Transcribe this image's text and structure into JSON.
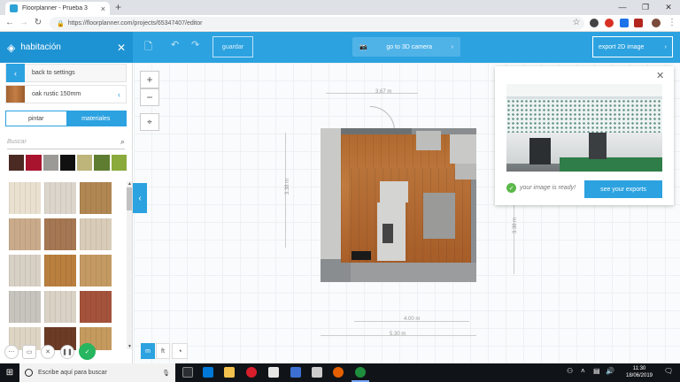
{
  "browser": {
    "tab_title": "Floorplanner - Prueba 3",
    "url": "https://floorplanner.com/projects/65347407/editor",
    "new_tab": "+",
    "tab_close": "×",
    "minimize": "—",
    "maximize": "❐",
    "close": "✕"
  },
  "sidebar": {
    "title": "habitación",
    "back_label": "back to settings",
    "material_label": "oak rustic 150mm",
    "tabs": [
      "pintar",
      "materiales"
    ],
    "search_placeholder": "Buscar",
    "swatch_colors": [
      "#4a2a22",
      "#a8142e",
      "#9c9a96",
      "#111111",
      "#bdb57a",
      "#5e7d30",
      "#8aaa3b"
    ],
    "textures": [
      [
        "#e9e0cf",
        "#dcd5cb",
        "#b08652"
      ],
      [
        "#c9ab8b",
        "#a57752",
        "#d8ccb8"
      ],
      [
        "#d7d0c5",
        "#b87f3e",
        "#c49a63"
      ],
      [
        "#c7c3bd",
        "#d9d2c5",
        "#a4523b"
      ],
      [
        "#ddd4c4",
        "#6b3b26",
        "#c49a5f"
      ]
    ]
  },
  "toolbar": {
    "save_label": "guardar",
    "camera_label": "go to 3D camera",
    "export_label": "export 2D image"
  },
  "canvas": {
    "dims": {
      "top": "3.67 m",
      "left": "3.38 m",
      "right": "3.38 m",
      "bottom_inner": "4.00 m",
      "bottom_outer": "5.30 m"
    },
    "units": [
      "m",
      "ft"
    ]
  },
  "export_popup": {
    "ready_text": "your image is ready!",
    "button_label": "see your exports"
  },
  "taskbar": {
    "search_placeholder": "Escribe aquí para buscar",
    "time": "11:30",
    "date": "18/06/2019"
  },
  "colors": {
    "accent": "#2ca2e0",
    "success": "#27b55f"
  }
}
